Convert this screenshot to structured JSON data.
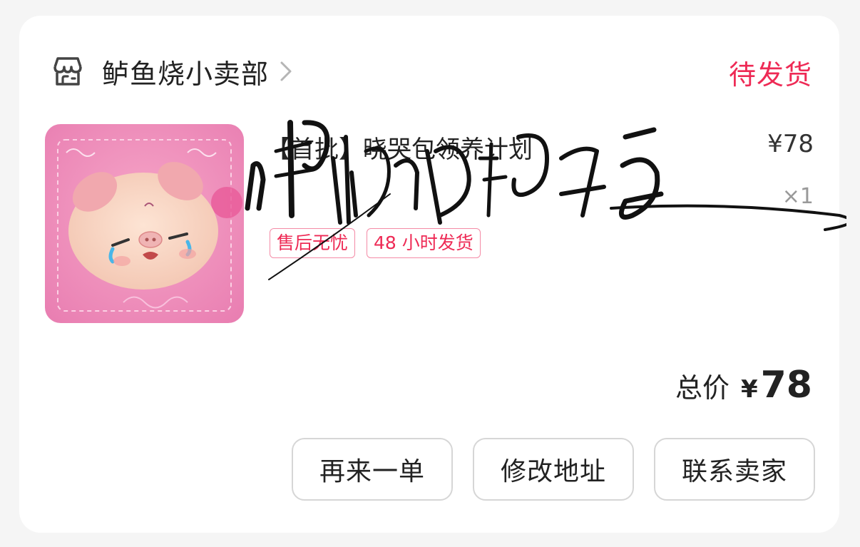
{
  "shop": {
    "name": "鲈鱼烧小卖部",
    "icon": "store-icon"
  },
  "order": {
    "status": "待发货",
    "status_color": "#ee2a55"
  },
  "product": {
    "title": "【首批】晓哭包领养计划",
    "price": "¥78",
    "quantity": "×1",
    "image_desc_icon": "pink-plush-pig-image",
    "tags": [
      "售后无忧",
      "48 小时发货"
    ]
  },
  "signature": {
    "text": "晓哭包领养"
  },
  "total": {
    "label": "总价",
    "currency": "¥",
    "value": "78"
  },
  "actions": {
    "reorder": "再来一单",
    "edit_address": "修改地址",
    "contact_seller": "联系卖家"
  }
}
